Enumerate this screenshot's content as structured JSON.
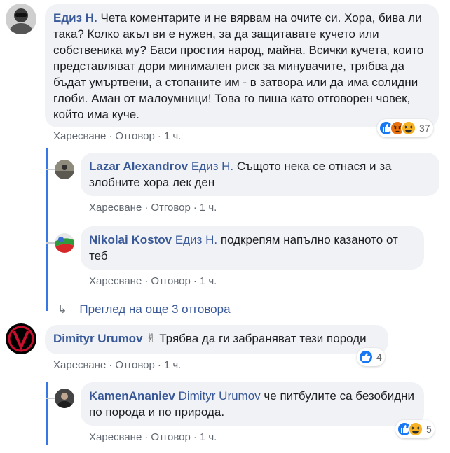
{
  "comments": [
    {
      "author": "Едиз Н.",
      "text": "Чета коментарите и не вярвам на очите си. Хора, бива ли така? Колко акъл ви е нужен, за да защитавате кучето или собственика му? Баси простия народ, майна. Всички кучета, които представляват дори минимален риск за минувачите, трябва да бъдат умъртвени, а стопаните им - в затвора или да има солидни глоби. Аман от малоумници! Това го пиша като отговорен човек, който има куче.",
      "like": "Харесване",
      "reply": "Отговор",
      "time": "1 ч.",
      "reaction_count": "37",
      "reaction_icons": [
        "like-icon",
        "angry-icon",
        "haha-icon"
      ]
    },
    {
      "author": "Lazar Alexandrov",
      "mention": "Едиз Н.",
      "text": "Същото нека се отнася и за злобните хора лек ден",
      "like": "Харесване",
      "reply": "Отговор",
      "time": "1 ч."
    },
    {
      "author": "Nikolai Kostov",
      "mention": "Едиз Н.",
      "text": "подкрепям напълно казаното от теб",
      "like": "Харесване",
      "reply": "Отговор",
      "time": "1 ч."
    },
    {
      "author": "Dimityr Urumov",
      "emoji": "✌",
      "text": "Трябва да ги забраняват тези породи",
      "like": "Харесване",
      "reply": "Отговор",
      "time": "1 ч.",
      "reaction_count": "4",
      "reaction_icons": [
        "like-icon"
      ]
    },
    {
      "author": "KamenAnaniev",
      "mention": "Dimityr Urumov",
      "text": "че питбулите са безобидни по порода и по природа.",
      "like": "Харесване",
      "reply": "Отговор",
      "time": "1 ч.",
      "reaction_count": "5",
      "reaction_icons": [
        "like-icon",
        "haha-icon"
      ]
    }
  ],
  "more_replies": "Преглед на още 3 отговора",
  "colors": {
    "link": "#385898",
    "like_blue": "#1877f2",
    "angry_orange": "#e9710f",
    "haha_yellow": "#f7b125",
    "thread_line": "#3578e5"
  }
}
